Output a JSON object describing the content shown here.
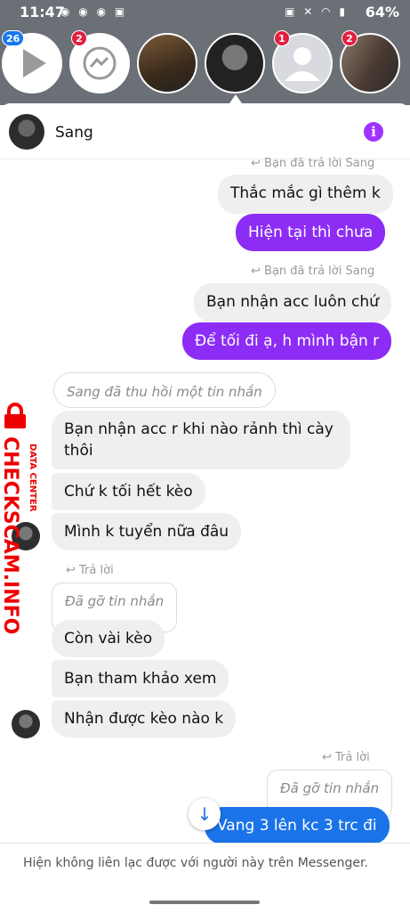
{
  "status_bar": {
    "time": "11:47",
    "battery": "64%",
    "left_icons": "◉ ◉ ◉ ▣",
    "right_icons": "▣ ✕ ◠ ▮"
  },
  "chat_heads": {
    "badges": [
      "26",
      "2",
      "1",
      "2"
    ]
  },
  "conversation": {
    "name": "Sang",
    "info_glyph": "i"
  },
  "watermark": {
    "brand": "CHECKSCAM.INFO",
    "sub": "DATA CENTER"
  },
  "messages": {
    "reply_note_1": "↩ Bạn đã trả lời Sang",
    "quoted_1": "Thắc mắc gì thêm k",
    "sent_1": "Hiện tại thì chưa",
    "reply_note_2": "↩ Bạn đã trả lời Sang",
    "quoted_2": "Bạn nhận acc luôn chứ",
    "sent_2": "Để tối đi ạ, h mình bận r",
    "unsent_note": "Sang đã thu hồi một tin nhắn",
    "recv_1_line1": "Bạn nhận acc r khi nào rảnh thì cày",
    "recv_1_line2": "thôi",
    "recv_2": "Chứ k tối hết kèo",
    "recv_3": "Mình k tuyển nữa đâu",
    "reply_note_3": "↩ Trả lời",
    "removed_1": "Đã gỡ tin nhắn",
    "recv_4": "Còn vài kèo",
    "recv_5": "Bạn tham khảo xem",
    "recv_6": "Nhận được kèo nào k",
    "reply_note_4": "↩ Trả lời",
    "removed_2": "Đã gỡ tin nhắn",
    "sent_3": "Vang 3 lên kc 3 trc đi"
  },
  "scroll_down_glyph": "↓",
  "footer": {
    "notice": "Hiện không liên lạc được với người này trên Messenger."
  },
  "colors": {
    "purple_bubble": "#8c2cf5",
    "blue_bubble": "#1a73e8",
    "badge_red": "#e41e3f",
    "watermark_red": "#e00000"
  }
}
